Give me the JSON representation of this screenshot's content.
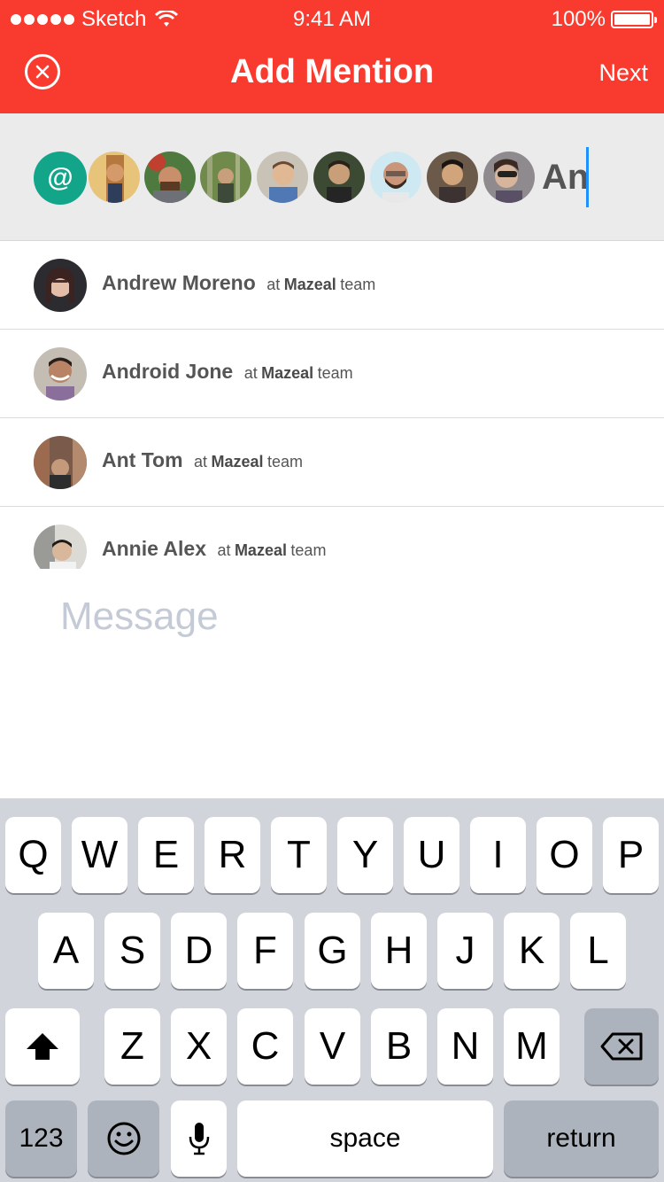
{
  "status_bar": {
    "carrier": "Sketch",
    "time": "9:41 AM",
    "battery": "100%"
  },
  "nav": {
    "title": "Add Mention",
    "next_label": "Next",
    "close_icon": "close-icon"
  },
  "colors": {
    "header_bg": "#f93b2f",
    "at_badge": "#12a58a",
    "caret": "#1e90ff",
    "keyboard_bg": "#d1d5db"
  },
  "mention_bar": {
    "at_symbol": "@",
    "query": "An"
  },
  "results": [
    {
      "name": "Andrew Moreno",
      "at": "at",
      "team_name": "Mazeal",
      "team": "team"
    },
    {
      "name": "Android Jone",
      "at": "at",
      "team_name": "Mazeal",
      "team": "team"
    },
    {
      "name": "Ant Tom",
      "at": "at",
      "team_name": "Mazeal",
      "team": "team"
    },
    {
      "name": "Annie Alex",
      "at": "at",
      "team_name": "Mazeal",
      "team": "team"
    }
  ],
  "message": {
    "placeholder": "Message"
  },
  "keyboard": {
    "row1": [
      "Q",
      "W",
      "E",
      "R",
      "T",
      "Y",
      "U",
      "I",
      "O",
      "P"
    ],
    "row2": [
      "A",
      "S",
      "D",
      "F",
      "G",
      "H",
      "J",
      "K",
      "L"
    ],
    "row3": [
      "Z",
      "X",
      "C",
      "V",
      "B",
      "N",
      "M"
    ],
    "numbers_label": "123",
    "space_label": "space",
    "return_label": "return"
  }
}
